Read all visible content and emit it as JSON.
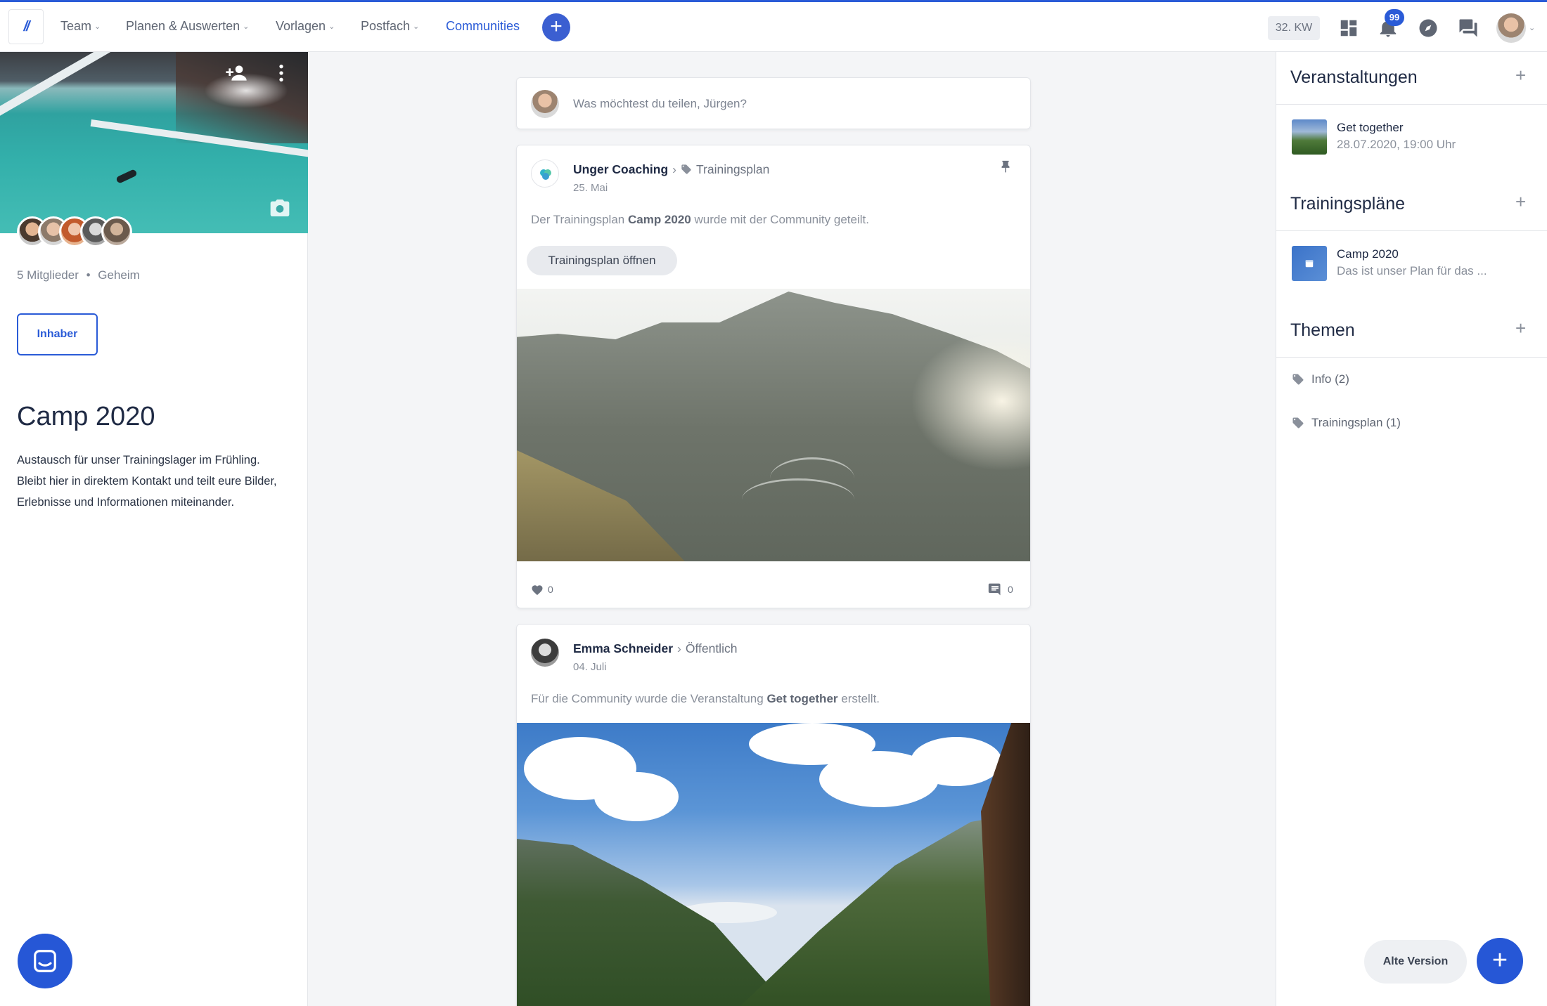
{
  "nav": {
    "logo": "//",
    "items": [
      {
        "label": "Team",
        "has_dropdown": true
      },
      {
        "label": "Planen & Auswerten",
        "has_dropdown": true
      },
      {
        "label": "Vorlagen",
        "has_dropdown": true
      },
      {
        "label": "Postfach",
        "has_dropdown": true
      },
      {
        "label": "Communities",
        "has_dropdown": false,
        "active": true
      }
    ],
    "add_icon": "plus-icon",
    "week_label": "32. KW",
    "icons": [
      "dashboard-icon",
      "bell-icon",
      "compass-icon",
      "chat-icon"
    ],
    "notification_count": "99",
    "accent_color": "#2a5bd7"
  },
  "community": {
    "member_count_label": "5 Mitglieder",
    "separator": "•",
    "visibility": "Geheim",
    "owner_button": "Inhaber",
    "title": "Camp 2020",
    "description": "Austausch für unser Trainingslager im Frühling. Bleibt hier in direktem Kontakt und teilt eure Bilder, Erlebnisse und Informationen miteinander.",
    "cover_icons": [
      "add-member-icon",
      "more-vertical-icon",
      "camera-icon"
    ]
  },
  "composer": {
    "placeholder": "Was möchtest du teilen, Jürgen?"
  },
  "posts": [
    {
      "author": "Unger Coaching",
      "separator": "›",
      "target": "Trainingsplan",
      "date": "25. Mai",
      "text_before": "Der Trainingsplan ",
      "text_bold": "Camp 2020",
      "text_after": " wurde mit der Community geteilt.",
      "action_label": "Trainingsplan öffnen",
      "likes": "0",
      "comments": "0",
      "pinned": true
    },
    {
      "author": "Emma Schneider",
      "separator": "›",
      "target": "Öffentlich",
      "date": "04. Juli",
      "text_before": "Für die Community wurde die Veranstaltung ",
      "text_bold": "Get together",
      "text_after": " erstellt."
    }
  ],
  "sidebar": {
    "events": {
      "title": "Veranstaltungen",
      "items": [
        {
          "title": "Get together",
          "subtitle": "28.07.2020, 19:00 Uhr"
        }
      ]
    },
    "plans": {
      "title": "Trainingspläne",
      "items": [
        {
          "title": "Camp 2020",
          "subtitle": "Das ist unser Plan für das ..."
        }
      ]
    },
    "topics": {
      "title": "Themen",
      "items": [
        {
          "label": "Info (2)"
        },
        {
          "label": "Trainingsplan (1)"
        }
      ]
    },
    "add_label": "+"
  },
  "footer": {
    "old_version_label": "Alte Version",
    "fab_label": "+"
  }
}
